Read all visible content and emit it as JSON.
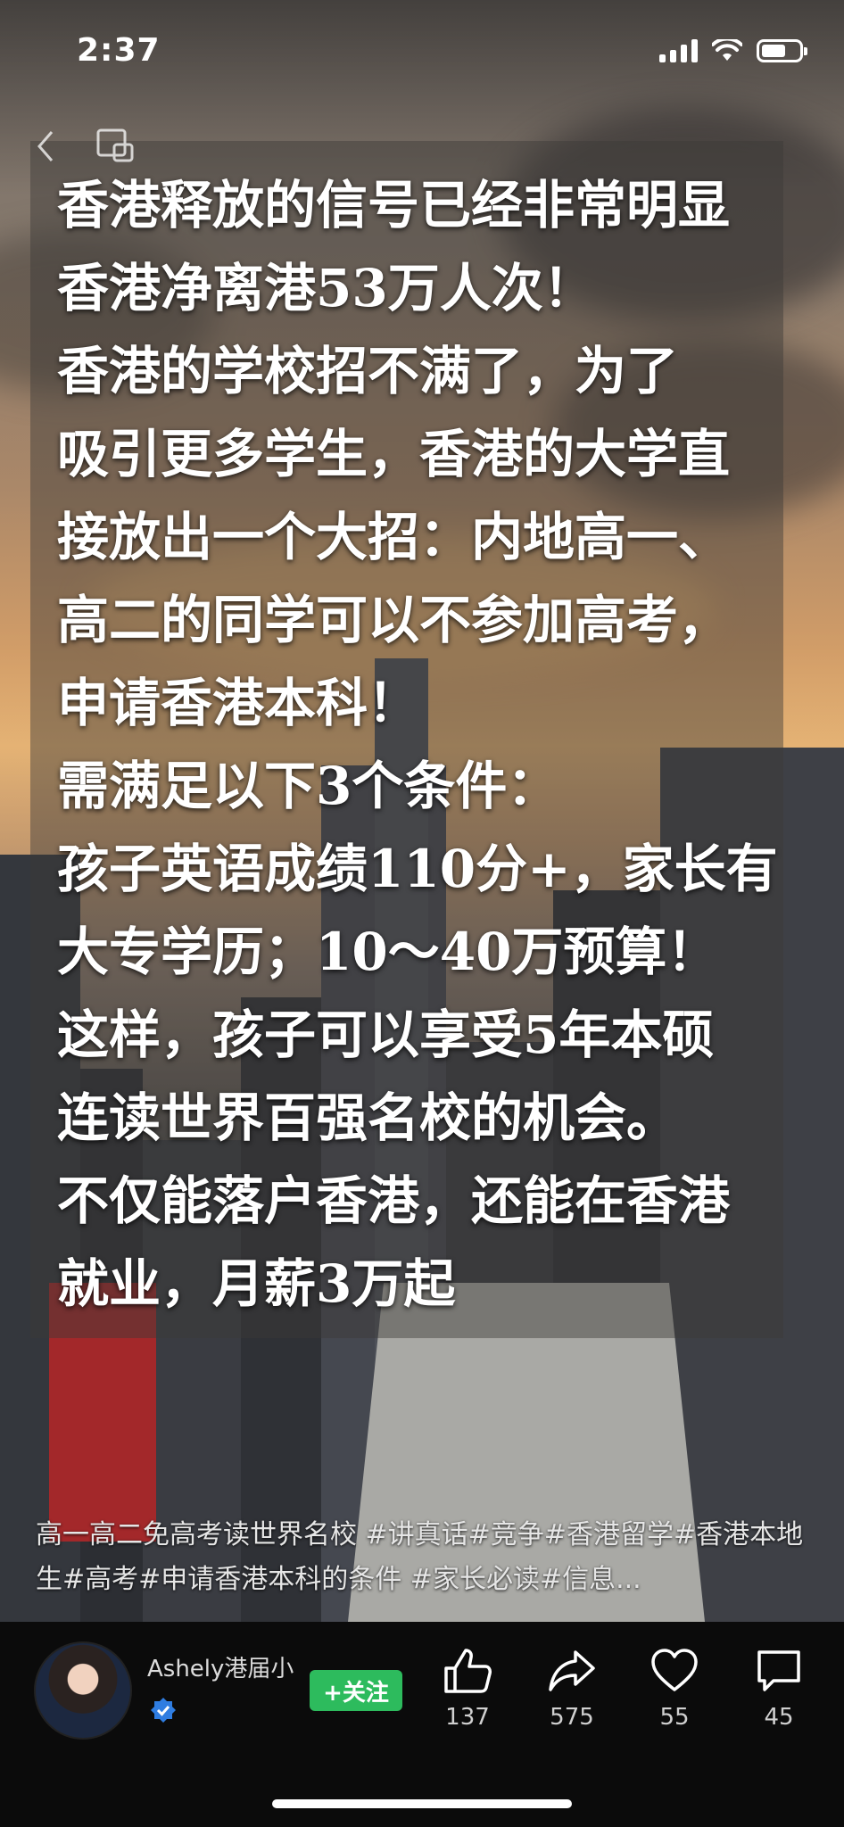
{
  "status_bar": {
    "time": "2:37"
  },
  "overlay": {
    "text": "香港释放的信号已经非常明显\n香港净离港53万人次！\n香港的学校招不满了，为了\n吸引更多学生，香港的大学直\n接放出一个大招：内地高一、\n高二的同学可以不参加高考，\n申请香港本科！\n需满足以下3个条件：\n孩子英语成绩110分+，家长有\n大专学历；10～40万预算！\n这样，孩子可以享受5年本硕\n连读世界百强名校的机会。\n不仅能落户香港，还能在香港\n就业，月薪3万起"
  },
  "caption": "高一高二免高考读世界名校 #讲真话#竞争#香港留学#香港本地生#高考#申请香港本科的条件 #家长必读#信息...",
  "author": {
    "name": "Ashely港届小"
  },
  "follow_label": "+关注",
  "actions": {
    "like": {
      "icon": "thumbs-up-icon",
      "count": "137"
    },
    "share": {
      "icon": "share-icon",
      "count": "575"
    },
    "favorite": {
      "icon": "heart-icon",
      "count": "55"
    },
    "comment": {
      "icon": "comment-icon",
      "count": "45"
    }
  },
  "colors": {
    "follow": "#2dbb5d",
    "verified": "#2f7de1",
    "bar_bg": "#0b0b0b"
  }
}
